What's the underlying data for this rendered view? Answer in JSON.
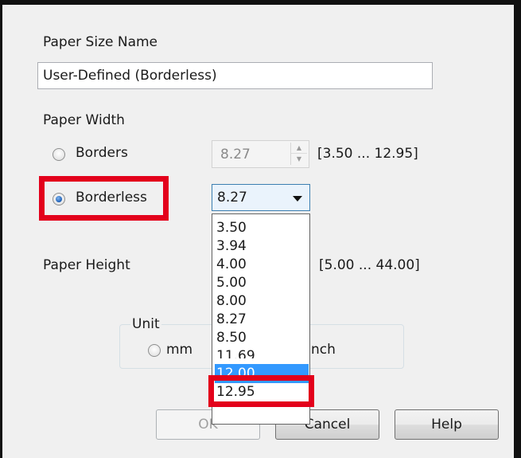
{
  "dialog": {
    "paper_size_name_label": "Paper Size Name",
    "paper_size_name_value": "User-Defined (Borderless)",
    "paper_width_label": "Paper Width",
    "borders_label": "Borders",
    "borderless_label": "Borderless",
    "width_spin_value": "8.27",
    "width_range": "[3.50 ... 12.95]",
    "width_combo_value": "8.27",
    "paper_height_label": "Paper Height",
    "height_range": "[5.00 ... 44.00]",
    "unit_label": "Unit",
    "unit_mm_label": "mm",
    "unit_inch_label": "nch"
  },
  "dropdown": {
    "options": [
      "3.50",
      "3.94",
      "4.00",
      "5.00",
      "8.00",
      "8.27",
      "8.50",
      "11.69",
      "12.00",
      "12.95"
    ],
    "selected": "12.00"
  },
  "buttons": {
    "ok": "OK",
    "cancel": "Cancel",
    "help": "Help"
  },
  "colors": {
    "highlight": "#e3001b",
    "selection": "#3399ff",
    "dialog_bg": "#f0f0f0"
  }
}
